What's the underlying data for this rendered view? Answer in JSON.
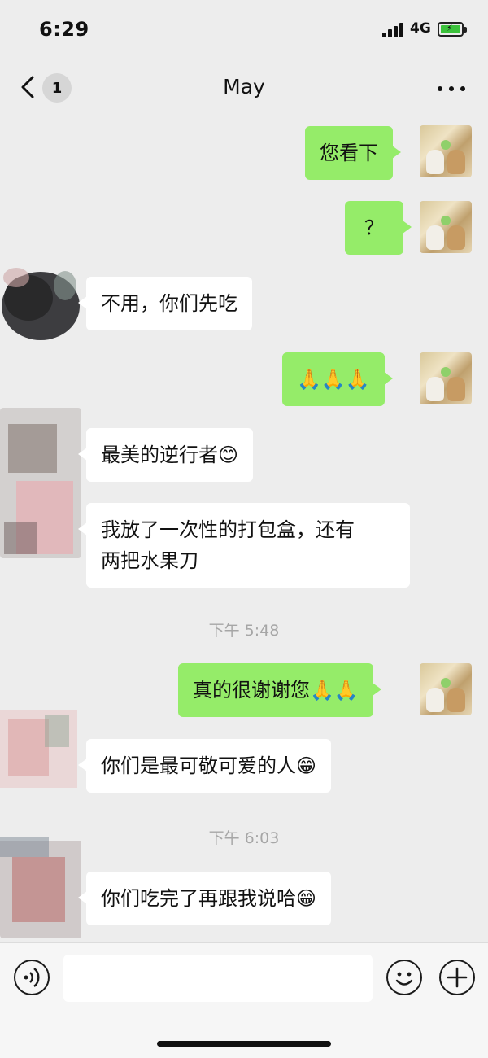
{
  "status_bar": {
    "time": "6:29",
    "network": "4G"
  },
  "nav": {
    "unread_count": "1",
    "title": "May"
  },
  "messages": [
    {
      "from": "me",
      "text": "您看下"
    },
    {
      "from": "me",
      "text": "？"
    },
    {
      "from": "other",
      "text": "不用，你们先吃"
    },
    {
      "from": "me",
      "text": "🙏🙏🙏"
    },
    {
      "from": "other",
      "text": "最美的逆行者😊"
    },
    {
      "from": "other",
      "text": "我放了一次性的打包盒，还有\n两把水果刀"
    },
    {
      "from": "time",
      "text": "下午 5:48"
    },
    {
      "from": "me",
      "text": "真的很谢谢您🙏🙏"
    },
    {
      "from": "other",
      "text": "你们是最可敬可爱的人😁"
    },
    {
      "from": "time",
      "text": "下午 6:03"
    },
    {
      "from": "other",
      "text": "你们吃完了再跟我说哈😁"
    }
  ],
  "input": {
    "value": "",
    "placeholder": ""
  },
  "icons": {
    "back": "chevron-left-icon",
    "more": "more-dots-icon",
    "voice": "voice-icon",
    "emoji": "emoji-icon",
    "plus": "plus-icon"
  },
  "colors": {
    "my_bubble": "#95ec69",
    "other_bubble": "#ffffff",
    "background": "#ededed",
    "timestamp": "#a6a6a6"
  }
}
